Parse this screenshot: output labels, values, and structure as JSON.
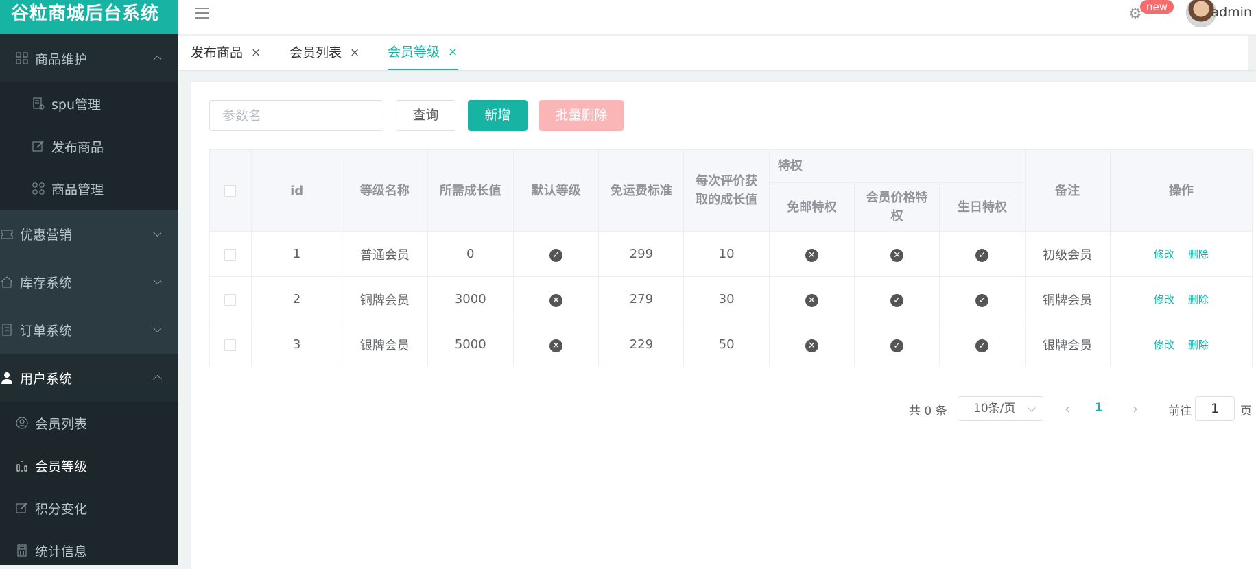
{
  "brand": "谷粒商城后台系统",
  "header": {
    "badge": "new",
    "username": "admin"
  },
  "sidebar": {
    "product_group": "商品维护",
    "product_items": [
      "spu管理",
      "发布商品",
      "商品管理"
    ],
    "groups": [
      "优惠营销",
      "库存系统",
      "订单系统"
    ],
    "user_group": "用户系统",
    "user_items": [
      "会员列表",
      "会员等级",
      "积分变化",
      "统计信息"
    ]
  },
  "tabs": [
    {
      "label": "发布商品",
      "close": "×"
    },
    {
      "label": "会员列表",
      "close": "×"
    },
    {
      "label": "会员等级",
      "close": "×"
    }
  ],
  "toolbar": {
    "search_placeholder": "参数名",
    "query": "查询",
    "add": "新增",
    "batch_delete": "批量删除"
  },
  "table": {
    "headers": {
      "id": "id",
      "name": "等级名称",
      "growth": "所需成长值",
      "default": "默认等级",
      "freight": "免运费标准",
      "comment_growth": "每次评价获取的成长值",
      "privilege": "特权",
      "free_ship": "免邮特权",
      "member_price": "会员价格特权",
      "birthday": "生日特权",
      "note": "备注",
      "ops": "操作"
    },
    "rows": [
      {
        "id": "1",
        "name": "普通会员",
        "growth": "0",
        "default": true,
        "freight": "299",
        "comment_growth": "10",
        "free_ship": false,
        "member_price": false,
        "birthday": true,
        "note": "初级会员",
        "edit": "修改",
        "delete": "删除"
      },
      {
        "id": "2",
        "name": "铜牌会员",
        "growth": "3000",
        "default": false,
        "freight": "279",
        "comment_growth": "30",
        "free_ship": false,
        "member_price": true,
        "birthday": true,
        "note": "铜牌会员",
        "edit": "修改",
        "delete": "删除"
      },
      {
        "id": "3",
        "name": "银牌会员",
        "growth": "5000",
        "default": false,
        "freight": "229",
        "comment_growth": "50",
        "free_ship": false,
        "member_price": true,
        "birthday": true,
        "note": "银牌会员",
        "edit": "修改",
        "delete": "删除"
      }
    ]
  },
  "pagination": {
    "total": "共 0 条",
    "page_size": "10条/页",
    "current_page": "1",
    "goto": "前往",
    "goto_value": "1",
    "page_unit": "页"
  },
  "colors": {
    "accent": "#17b3a3",
    "sidebar": "#222d32",
    "danger_light": "#fab6b6",
    "badge": "#f56c6c"
  }
}
